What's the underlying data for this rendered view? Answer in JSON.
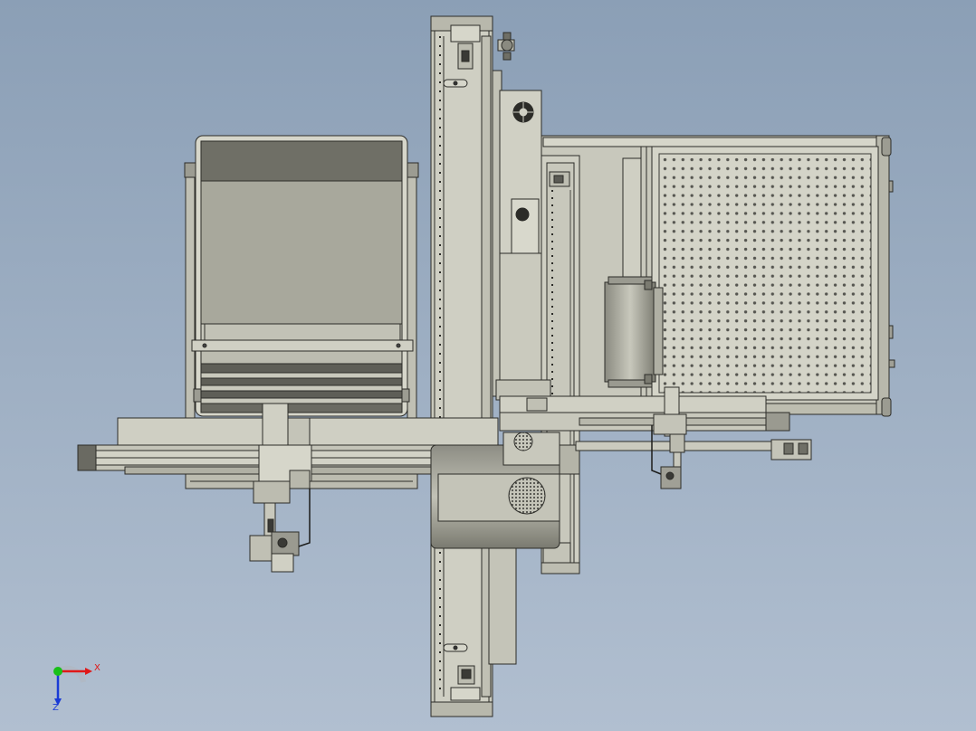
{
  "view": {
    "background_top": "#8b9fb6",
    "background_bottom": "#b1bfd0"
  },
  "triad": {
    "x_label": "X",
    "z_label": "Z",
    "x_color": "#e01818",
    "y_color": "#18c018",
    "z_color": "#1a3bd6"
  },
  "model": {
    "part_fill": "#c9c9bc",
    "part_dark": "#8b8b80",
    "edge": "#2c2c28"
  }
}
